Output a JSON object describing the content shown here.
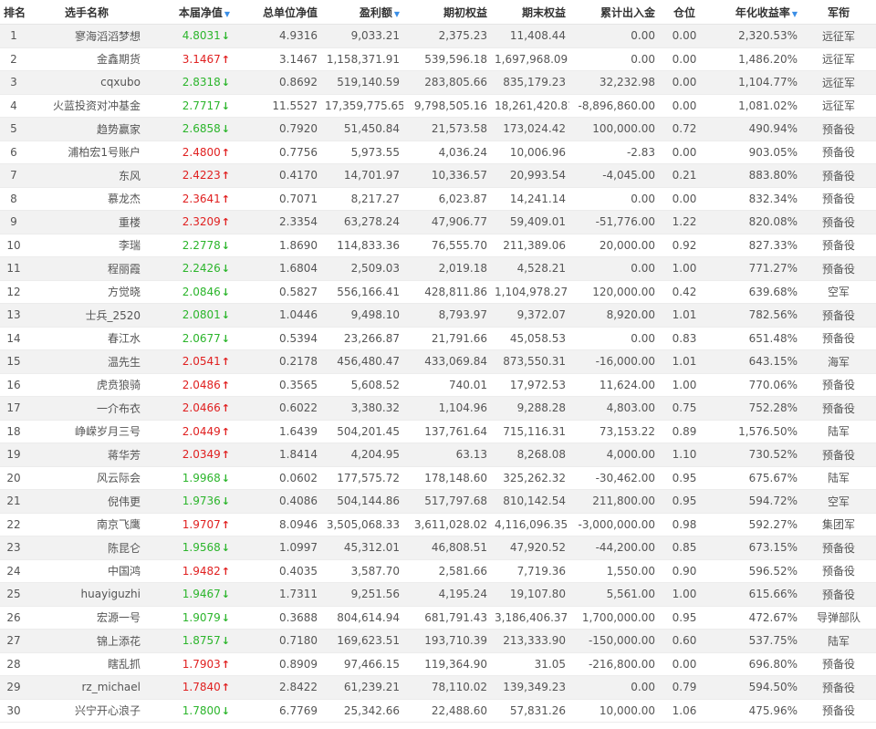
{
  "headers": {
    "rank": "排名",
    "name": "选手名称",
    "nav": "本届净值",
    "total_nav": "总单位净值",
    "profit": "盈利额",
    "start_equity": "期初权益",
    "end_equity": "期末权益",
    "net_flow": "累计出入金",
    "position": "仓位",
    "annual_return": "年化收益率",
    "rank_title": "军衔"
  },
  "colors": {
    "up": "#e02020",
    "down": "#2bb52b",
    "sort_arrow": "#3a8ee6"
  },
  "rows": [
    {
      "rank": "1",
      "name": "寥海滔滔梦想",
      "nav": "4.8031",
      "dir": "down",
      "total_nav": "4.9316",
      "profit": "9,033.21",
      "start": "2,375.23",
      "end": "11,408.44",
      "flow": "0.00",
      "pos": "0.00",
      "annual": "2,320.53%",
      "title": "远征军"
    },
    {
      "rank": "2",
      "name": "金鑫期货",
      "nav": "3.1467",
      "dir": "up",
      "total_nav": "3.1467",
      "profit": "1,158,371.91",
      "start": "539,596.18",
      "end": "1,697,968.09",
      "flow": "0.00",
      "pos": "0.00",
      "annual": "1,486.20%",
      "title": "远征军"
    },
    {
      "rank": "3",
      "name": "cqxubo",
      "nav": "2.8318",
      "dir": "down",
      "total_nav": "0.8692",
      "profit": "519,140.59",
      "start": "283,805.66",
      "end": "835,179.23",
      "flow": "32,232.98",
      "pos": "0.00",
      "annual": "1,104.77%",
      "title": "远征军"
    },
    {
      "rank": "4",
      "name": "火蓝投资对冲基金",
      "nav": "2.7717",
      "dir": "down",
      "total_nav": "11.5527",
      "profit": "17,359,775.65",
      "start": "9,798,505.16",
      "end": "18,261,420.81",
      "flow": "-8,896,860.00",
      "pos": "0.00",
      "annual": "1,081.02%",
      "title": "远征军"
    },
    {
      "rank": "5",
      "name": "趋势赢家",
      "nav": "2.6858",
      "dir": "down",
      "total_nav": "0.7920",
      "profit": "51,450.84",
      "start": "21,573.58",
      "end": "173,024.42",
      "flow": "100,000.00",
      "pos": "0.72",
      "annual": "490.94%",
      "title": "预备役"
    },
    {
      "rank": "6",
      "name": "浦柏宏1号账户",
      "nav": "2.4800",
      "dir": "up",
      "total_nav": "0.7756",
      "profit": "5,973.55",
      "start": "4,036.24",
      "end": "10,006.96",
      "flow": "-2.83",
      "pos": "0.00",
      "annual": "903.05%",
      "title": "预备役"
    },
    {
      "rank": "7",
      "name": "东风",
      "nav": "2.4223",
      "dir": "up",
      "total_nav": "0.4170",
      "profit": "14,701.97",
      "start": "10,336.57",
      "end": "20,993.54",
      "flow": "-4,045.00",
      "pos": "0.21",
      "annual": "883.80%",
      "title": "预备役"
    },
    {
      "rank": "8",
      "name": "慕龙杰",
      "nav": "2.3641",
      "dir": "up",
      "total_nav": "0.7071",
      "profit": "8,217.27",
      "start": "6,023.87",
      "end": "14,241.14",
      "flow": "0.00",
      "pos": "0.00",
      "annual": "832.34%",
      "title": "预备役"
    },
    {
      "rank": "9",
      "name": "重楼",
      "nav": "2.3209",
      "dir": "up",
      "total_nav": "2.3354",
      "profit": "63,278.24",
      "start": "47,906.77",
      "end": "59,409.01",
      "flow": "-51,776.00",
      "pos": "1.22",
      "annual": "820.08%",
      "title": "预备役"
    },
    {
      "rank": "10",
      "name": "李瑞",
      "nav": "2.2778",
      "dir": "down",
      "total_nav": "1.8690",
      "profit": "114,833.36",
      "start": "76,555.70",
      "end": "211,389.06",
      "flow": "20,000.00",
      "pos": "0.92",
      "annual": "827.33%",
      "title": "预备役"
    },
    {
      "rank": "11",
      "name": "程丽霞",
      "nav": "2.2426",
      "dir": "down",
      "total_nav": "1.6804",
      "profit": "2,509.03",
      "start": "2,019.18",
      "end": "4,528.21",
      "flow": "0.00",
      "pos": "1.00",
      "annual": "771.27%",
      "title": "预备役"
    },
    {
      "rank": "12",
      "name": "方觉晓",
      "nav": "2.0846",
      "dir": "down",
      "total_nav": "0.5827",
      "profit": "556,166.41",
      "start": "428,811.86",
      "end": "1,104,978.27",
      "flow": "120,000.00",
      "pos": "0.42",
      "annual": "639.68%",
      "title": "空军"
    },
    {
      "rank": "13",
      "name": "士兵_2520",
      "nav": "2.0801",
      "dir": "down",
      "total_nav": "1.0446",
      "profit": "9,498.10",
      "start": "8,793.97",
      "end": "9,372.07",
      "flow": "8,920.00",
      "pos": "1.01",
      "annual": "782.56%",
      "title": "预备役"
    },
    {
      "rank": "14",
      "name": "春江水",
      "nav": "2.0677",
      "dir": "down",
      "total_nav": "0.5394",
      "profit": "23,266.87",
      "start": "21,791.66",
      "end": "45,058.53",
      "flow": "0.00",
      "pos": "0.83",
      "annual": "651.48%",
      "title": "预备役"
    },
    {
      "rank": "15",
      "name": "温先生",
      "nav": "2.0541",
      "dir": "up",
      "total_nav": "0.2178",
      "profit": "456,480.47",
      "start": "433,069.84",
      "end": "873,550.31",
      "flow": "-16,000.00",
      "pos": "1.01",
      "annual": "643.15%",
      "title": "海军"
    },
    {
      "rank": "16",
      "name": "虎贲狼骑",
      "nav": "2.0486",
      "dir": "up",
      "total_nav": "0.3565",
      "profit": "5,608.52",
      "start": "740.01",
      "end": "17,972.53",
      "flow": "11,624.00",
      "pos": "1.00",
      "annual": "770.06%",
      "title": "预备役"
    },
    {
      "rank": "17",
      "name": "一介布衣",
      "nav": "2.0466",
      "dir": "up",
      "total_nav": "0.6022",
      "profit": "3,380.32",
      "start": "1,104.96",
      "end": "9,288.28",
      "flow": "4,803.00",
      "pos": "0.75",
      "annual": "752.28%",
      "title": "预备役"
    },
    {
      "rank": "18",
      "name": "峥嵘岁月三号",
      "nav": "2.0449",
      "dir": "up",
      "total_nav": "1.6439",
      "profit": "504,201.45",
      "start": "137,761.64",
      "end": "715,116.31",
      "flow": "73,153.22",
      "pos": "0.89",
      "annual": "1,576.50%",
      "title": "陆军"
    },
    {
      "rank": "19",
      "name": "蒋华芳",
      "nav": "2.0349",
      "dir": "up",
      "total_nav": "1.8414",
      "profit": "4,204.95",
      "start": "63.13",
      "end": "8,268.08",
      "flow": "4,000.00",
      "pos": "1.10",
      "annual": "730.52%",
      "title": "预备役"
    },
    {
      "rank": "20",
      "name": "风云际会",
      "nav": "1.9968",
      "dir": "down",
      "total_nav": "0.0602",
      "profit": "177,575.72",
      "start": "178,148.60",
      "end": "325,262.32",
      "flow": "-30,462.00",
      "pos": "0.95",
      "annual": "675.67%",
      "title": "陆军"
    },
    {
      "rank": "21",
      "name": "倪伟更",
      "nav": "1.9736",
      "dir": "down",
      "total_nav": "0.4086",
      "profit": "504,144.86",
      "start": "517,797.68",
      "end": "810,142.54",
      "flow": "211,800.00",
      "pos": "0.95",
      "annual": "594.72%",
      "title": "空军"
    },
    {
      "rank": "22",
      "name": "南京飞鹰",
      "nav": "1.9707",
      "dir": "up",
      "total_nav": "8.0946",
      "profit": "3,505,068.33",
      "start": "3,611,028.02",
      "end": "4,116,096.35",
      "flow": "-3,000,000.00",
      "pos": "0.98",
      "annual": "592.27%",
      "title": "集团军"
    },
    {
      "rank": "23",
      "name": "陈昆仑",
      "nav": "1.9568",
      "dir": "down",
      "total_nav": "1.0997",
      "profit": "45,312.01",
      "start": "46,808.51",
      "end": "47,920.52",
      "flow": "-44,200.00",
      "pos": "0.85",
      "annual": "673.15%",
      "title": "预备役"
    },
    {
      "rank": "24",
      "name": "中国鸿",
      "nav": "1.9482",
      "dir": "up",
      "total_nav": "0.4035",
      "profit": "3,587.70",
      "start": "2,581.66",
      "end": "7,719.36",
      "flow": "1,550.00",
      "pos": "0.90",
      "annual": "596.52%",
      "title": "预备役"
    },
    {
      "rank": "25",
      "name": "huayiguzhi",
      "nav": "1.9467",
      "dir": "down",
      "total_nav": "1.7311",
      "profit": "9,251.56",
      "start": "4,195.24",
      "end": "19,107.80",
      "flow": "5,561.00",
      "pos": "1.00",
      "annual": "615.66%",
      "title": "预备役"
    },
    {
      "rank": "26",
      "name": "宏源一号",
      "nav": "1.9079",
      "dir": "down",
      "total_nav": "0.3688",
      "profit": "804,614.94",
      "start": "681,791.43",
      "end": "3,186,406.37",
      "flow": "1,700,000.00",
      "pos": "0.95",
      "annual": "472.67%",
      "title": "导弹部队"
    },
    {
      "rank": "27",
      "name": "锦上添花",
      "nav": "1.8757",
      "dir": "down",
      "total_nav": "0.7180",
      "profit": "169,623.51",
      "start": "193,710.39",
      "end": "213,333.90",
      "flow": "-150,000.00",
      "pos": "0.60",
      "annual": "537.75%",
      "title": "陆军"
    },
    {
      "rank": "28",
      "name": "瞎乱抓",
      "nav": "1.7903",
      "dir": "up",
      "total_nav": "0.8909",
      "profit": "97,466.15",
      "start": "119,364.90",
      "end": "31.05",
      "flow": "-216,800.00",
      "pos": "0.00",
      "annual": "696.80%",
      "title": "预备役"
    },
    {
      "rank": "29",
      "name": "rz_michael",
      "nav": "1.7840",
      "dir": "up",
      "total_nav": "2.8422",
      "profit": "61,239.21",
      "start": "78,110.02",
      "end": "139,349.23",
      "flow": "0.00",
      "pos": "0.79",
      "annual": "594.50%",
      "title": "预备役"
    },
    {
      "rank": "30",
      "name": "兴宁开心浪子",
      "nav": "1.7800",
      "dir": "down",
      "total_nav": "6.7769",
      "profit": "25,342.66",
      "start": "22,488.60",
      "end": "57,831.26",
      "flow": "10,000.00",
      "pos": "1.06",
      "annual": "475.96%",
      "title": "预备役"
    }
  ]
}
